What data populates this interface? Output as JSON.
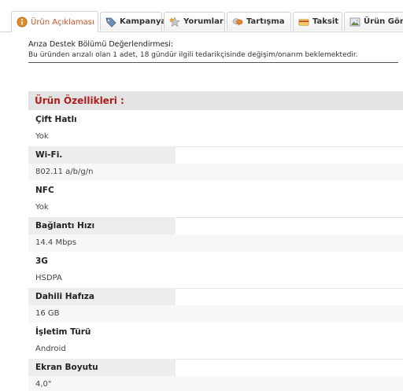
{
  "tabs": [
    {
      "label": "Ürün Açıklaması",
      "icon": "info-icon",
      "active": true
    },
    {
      "label": "Kampanya",
      "icon": "tag-icon",
      "active": false
    },
    {
      "label": "Yorumlar",
      "icon": "star-comment-icon",
      "active": false
    },
    {
      "label": "Tartışma",
      "icon": "chat-bubbles-icon",
      "active": false
    },
    {
      "label": "Taksit",
      "icon": "credit-card-icon",
      "active": false
    },
    {
      "label": "Ürün Görs",
      "icon": "image-icon",
      "active": false
    }
  ],
  "description": {
    "title": "Arıza Destek Bölümü Değerlendirmesi:",
    "text": "Bu üründen arızalı olan 1 adet, 18 gündür ilgili tedarikçisinde değişim/onarım beklemektedir."
  },
  "features": {
    "header": "Ürün Özellikleri :",
    "items": [
      {
        "label": "Çift Hatlı",
        "value": "Yok"
      },
      {
        "label": "Wi-Fi.",
        "value": "802.11 a/b/g/n"
      },
      {
        "label": "NFC",
        "value": "Yok"
      },
      {
        "label": "Bağlantı Hızı",
        "value": "14.4 Mbps"
      },
      {
        "label": "3G",
        "value": "HSDPA"
      },
      {
        "label": "Dahili Hafıza",
        "value": "16 GB"
      },
      {
        "label": "İşletim Türü",
        "value": "Android"
      },
      {
        "label": "Ekran Boyutu",
        "value": "4,0\""
      }
    ]
  },
  "colors": {
    "accent": "#c4502a",
    "header_text": "#b11c1c",
    "header_bg": "#e3e3e3"
  }
}
